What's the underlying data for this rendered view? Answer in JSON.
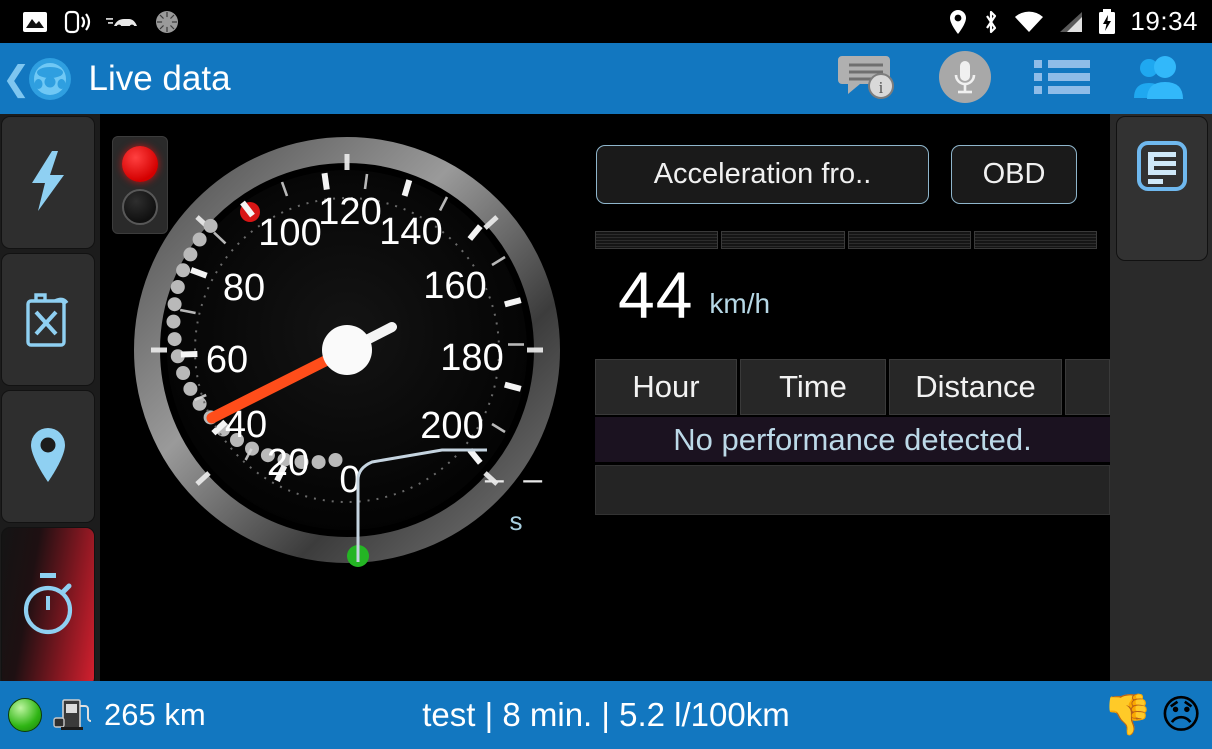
{
  "status_bar": {
    "time": "19:34",
    "left_icons": [
      "image-icon",
      "phone-vibrate-icon",
      "car-icon",
      "sync-spinner-icon"
    ],
    "right_icons": [
      "location-pin-icon",
      "bluetooth-icon",
      "wifi-icon",
      "cell-signal-icon",
      "battery-charging-icon"
    ]
  },
  "header": {
    "back_glyph": "❮",
    "title": "Live data",
    "icons": [
      "chat-info-icon",
      "microphone-icon",
      "list-icon",
      "users-icon"
    ],
    "bg_color": "#1277c0"
  },
  "sidebar_left": {
    "items": [
      {
        "name": "lightning-bolt",
        "active": false
      },
      {
        "name": "fuel-canister-disabled",
        "active": false
      },
      {
        "name": "location-pin",
        "active": false
      },
      {
        "name": "stopwatch",
        "active": true
      }
    ],
    "active_color": "#d4202f",
    "icon_color": "#8fd0f2"
  },
  "sidebar_right": {
    "items": [
      {
        "name": "document-list",
        "active": false
      }
    ]
  },
  "gauge": {
    "unit": "km/h",
    "min": 0,
    "max": 200,
    "tick_labels": [
      "0",
      "20",
      "40",
      "60",
      "80",
      "100",
      "120",
      "140",
      "160",
      "180",
      "200"
    ],
    "needle_value": 44,
    "needle_color": "#ff4d1a",
    "marker_red_value": 110,
    "marker_green_value": 0,
    "traffic_light": {
      "red_on": true,
      "lower_on": false
    }
  },
  "timer": {
    "value": "– –",
    "unit": "s"
  },
  "controls": {
    "mode_button": "Acceleration fro..",
    "source_button": "OBD"
  },
  "progress": {
    "segments": 4
  },
  "readout": {
    "value": "44",
    "unit": "km/h"
  },
  "table": {
    "headers": [
      "Hour",
      "Time",
      "Distance",
      ""
    ],
    "message": "No performance detected.",
    "rows": []
  },
  "bottom_bar": {
    "range": "265 km",
    "trip_summary": "test  |  8 min.  |  5.2 l/100km",
    "icons": [
      "fuel-pump-icon",
      "green-status-dot"
    ],
    "emojis": [
      "thumbs-down-emoji",
      "disappointed-face-emoji"
    ],
    "bg_color": "#1277c0"
  }
}
